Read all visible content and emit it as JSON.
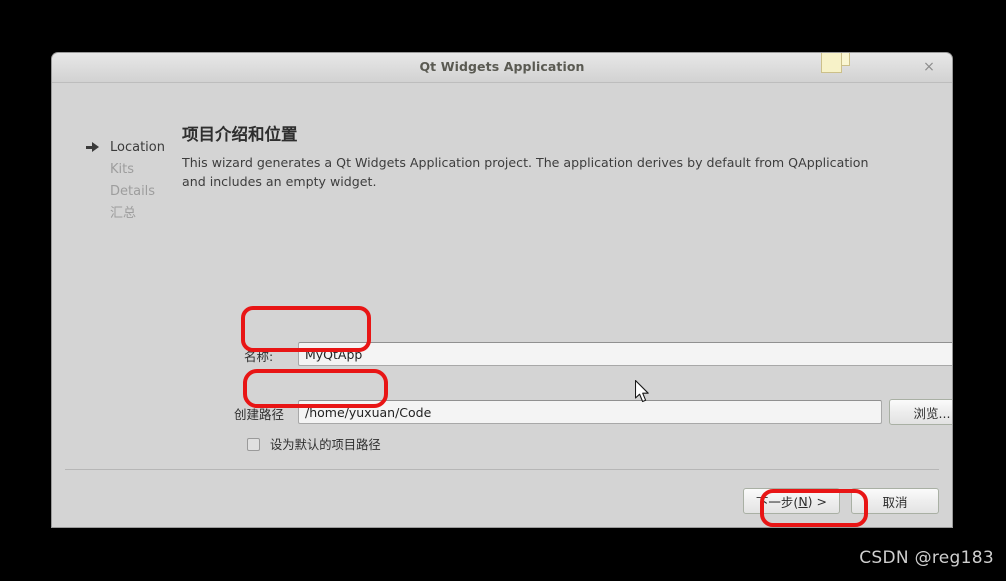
{
  "window": {
    "title": "Qt Widgets Application",
    "icon": "stacked-windows-icon",
    "close_label": "×"
  },
  "sidebar": {
    "items": [
      {
        "label": "Location",
        "active": true
      },
      {
        "label": "Kits",
        "active": false
      },
      {
        "label": "Details",
        "active": false
      },
      {
        "label": "汇总",
        "active": false
      }
    ]
  },
  "content": {
    "heading": "项目介绍和位置",
    "description": "This wizard generates a Qt Widgets Application project. The application derives by default from QApplication and includes an empty widget.",
    "fields": {
      "name": {
        "label": "名称:",
        "value": "MyQtApp",
        "placeholder": ""
      },
      "path": {
        "label": "创建路径",
        "value": "/home/yuxuan/Code",
        "placeholder": "",
        "browse_label": "浏览..."
      }
    },
    "checkbox": {
      "label": "设为默认的项目路径",
      "checked": false
    }
  },
  "footer": {
    "next_prefix": "下一步(",
    "next_mnemonic": "N",
    "next_suffix": ") >",
    "cancel_label": "取消"
  },
  "watermark": {
    "text": "CSDN @reg183"
  },
  "colors": {
    "annotation": "#e81515",
    "dialog_bg": "#d4d4d4",
    "title_text": "#5a5a52",
    "window_icon": "#faf6d2"
  }
}
